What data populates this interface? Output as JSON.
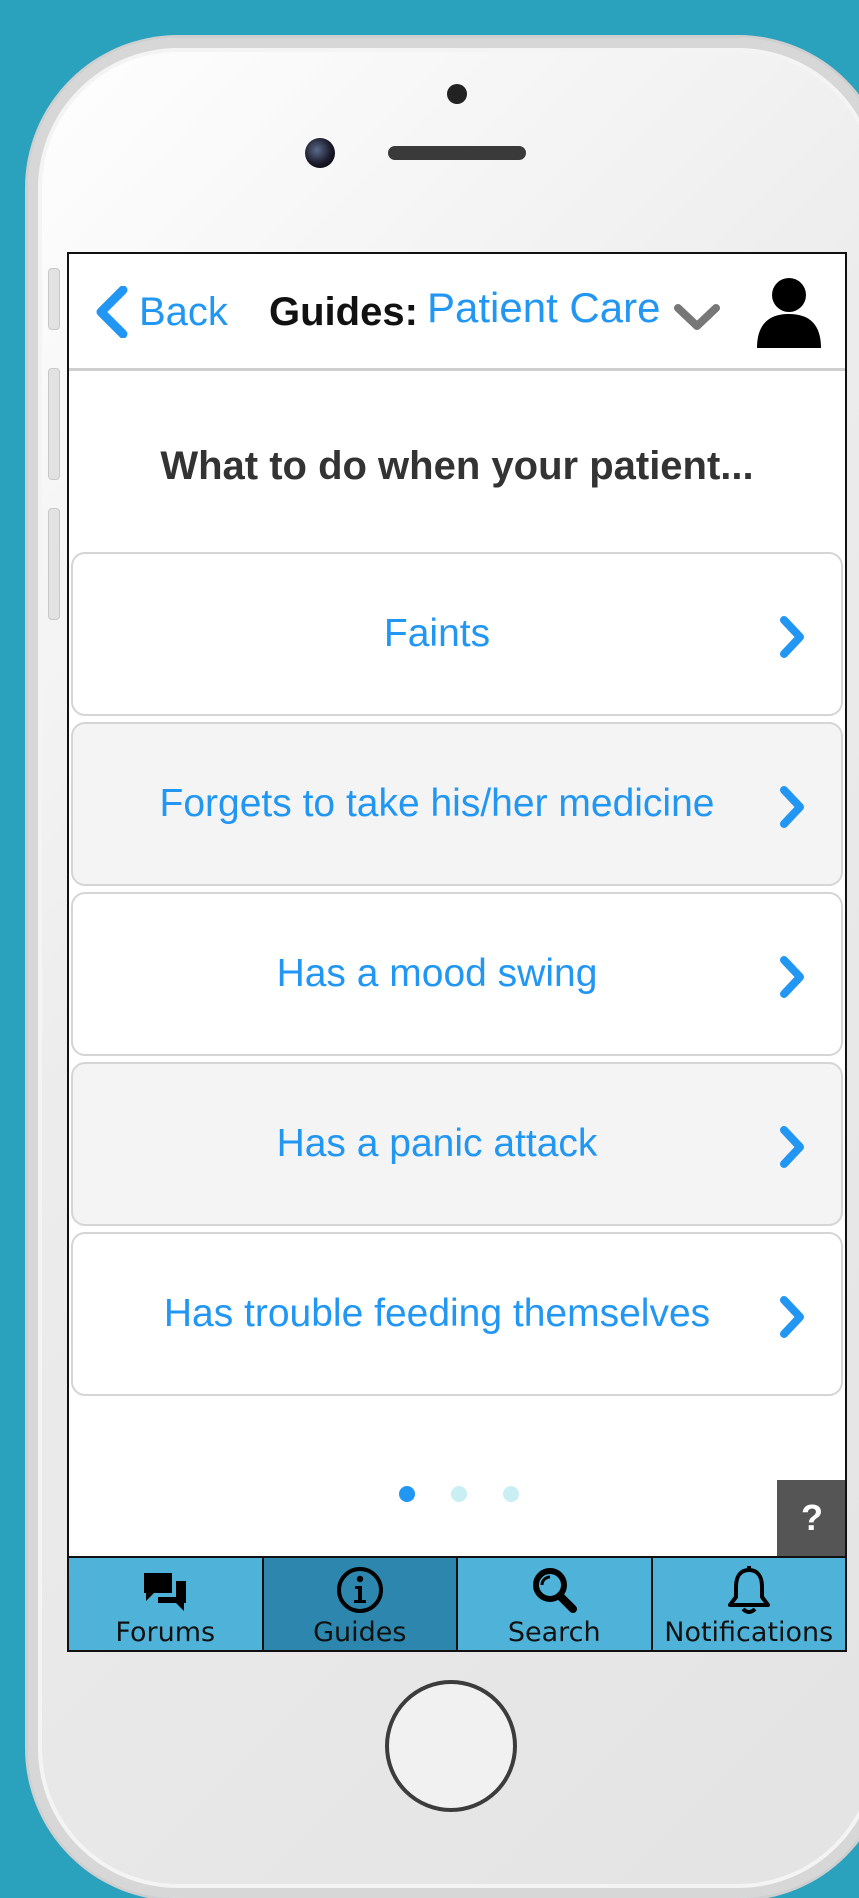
{
  "header": {
    "back_label": "Back",
    "guides_label": "Guides:",
    "guides_value": "Patient Care"
  },
  "question": "What to do when your patient...",
  "items": [
    {
      "label": "Faints"
    },
    {
      "label": "Forgets to take his/her medicine"
    },
    {
      "label": "Has a mood swing"
    },
    {
      "label": "Has a panic attack"
    },
    {
      "label": "Has trouble feeding themselves"
    }
  ],
  "pager": {
    "count": 3,
    "active_index": 0
  },
  "help_label": "?",
  "tabs": [
    {
      "label": "Forums",
      "icon": "chat-bubbles-icon"
    },
    {
      "label": "Guides",
      "icon": "info-icon",
      "active": true
    },
    {
      "label": "Search",
      "icon": "magnifier-icon"
    },
    {
      "label": "Notifications",
      "icon": "bell-icon"
    }
  ],
  "colors": {
    "accent": "#2196f3",
    "background": "#2aa1bd",
    "tab_bar": "#4fb3d9",
    "tab_active": "#2d86ad"
  }
}
